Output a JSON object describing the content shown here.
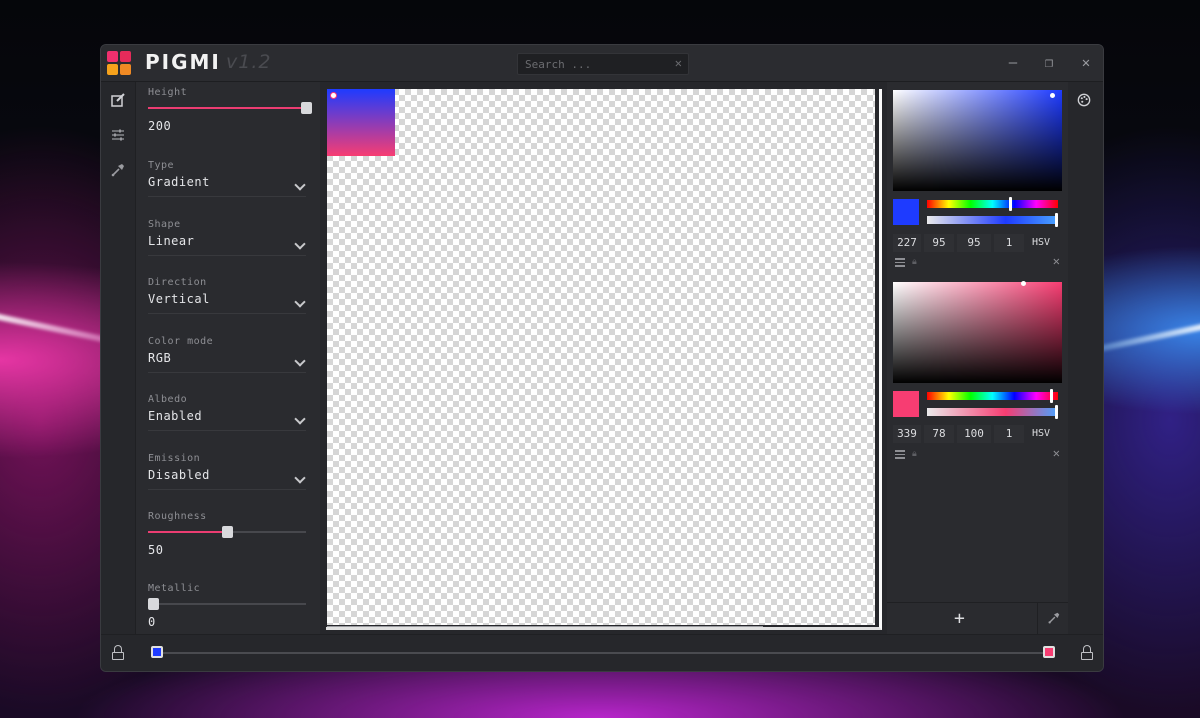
{
  "app": {
    "title": "PIGMI",
    "version": "v1.2"
  },
  "search": {
    "placeholder": "Search ..."
  },
  "settings": {
    "height": {
      "label": "Height",
      "value": "200",
      "level": 1.0
    },
    "type": {
      "label": "Type",
      "value": "Gradient"
    },
    "shape": {
      "label": "Shape",
      "value": "Linear"
    },
    "direction": {
      "label": "Direction",
      "value": "Vertical"
    },
    "color_mode": {
      "label": "Color mode",
      "value": "RGB"
    },
    "albedo": {
      "label": "Albedo",
      "value": "Enabled"
    },
    "emission": {
      "label": "Emission",
      "value": "Disabled"
    },
    "roughness": {
      "label": "Roughness",
      "value": "50",
      "level": 0.5
    },
    "metallic": {
      "label": "Metallic",
      "value": "0",
      "level": 0.0
    }
  },
  "colors": [
    {
      "hex": "#1e3bff",
      "h": "227",
      "s": "95",
      "v": "95",
      "a": "1",
      "mode": "HSV"
    },
    {
      "hex": "#f73d72",
      "h": "339",
      "s": "78",
      "v": "100",
      "a": "1",
      "mode": "HSV"
    }
  ],
  "add_color": {
    "label": "+"
  },
  "icons": {
    "close": "✕",
    "minimize": "—",
    "restore": "❐",
    "search_clear": "✕"
  }
}
